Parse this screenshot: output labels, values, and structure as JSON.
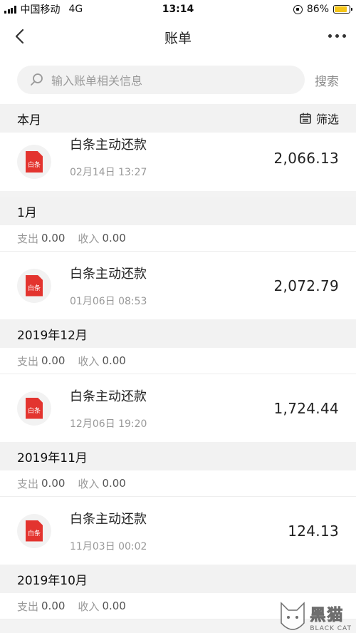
{
  "status_bar": {
    "carrier": "中国移动",
    "network": "4G",
    "time": "13:14",
    "battery": "86%",
    "battery_level": 0.86
  },
  "nav": {
    "title": "账单",
    "back_icon": "chevron-left-icon",
    "more_icon": "more-icon"
  },
  "search": {
    "placeholder": "输入账单相关信息",
    "button": "搜索"
  },
  "current_month": {
    "label": "本月",
    "filter_label": "筛选",
    "records": [
      {
        "title": "白条主动还款",
        "time": "02月14日 13:27",
        "amount": "2,066.13"
      }
    ]
  },
  "months": [
    {
      "label": "1月",
      "expense_label": "支出",
      "expense": "0.00",
      "income_label": "收入",
      "income": "0.00",
      "records": [
        {
          "title": "白条主动还款",
          "time": "01月06日 08:53",
          "amount": "2,072.79"
        }
      ]
    },
    {
      "label": "2019年12月",
      "expense_label": "支出",
      "expense": "0.00",
      "income_label": "收入",
      "income": "0.00",
      "records": [
        {
          "title": "白条主动还款",
          "time": "12月06日 19:20",
          "amount": "1,724.44"
        }
      ]
    },
    {
      "label": "2019年11月",
      "expense_label": "支出",
      "expense": "0.00",
      "income_label": "收入",
      "income": "0.00",
      "records": [
        {
          "title": "白条主动还款",
          "time": "11月03日 00:02",
          "amount": "124.13"
        }
      ]
    },
    {
      "label": "2019年10月",
      "expense_label": "支出",
      "expense": "0.00",
      "income_label": "收入",
      "income": "0.00",
      "records": []
    }
  ],
  "logo_text": "白条",
  "watermark": {
    "cn": "黑猫",
    "en": "BLACK CAT"
  },
  "colors": {
    "brand_red": "#e3342f",
    "battery": "#f5c518"
  }
}
